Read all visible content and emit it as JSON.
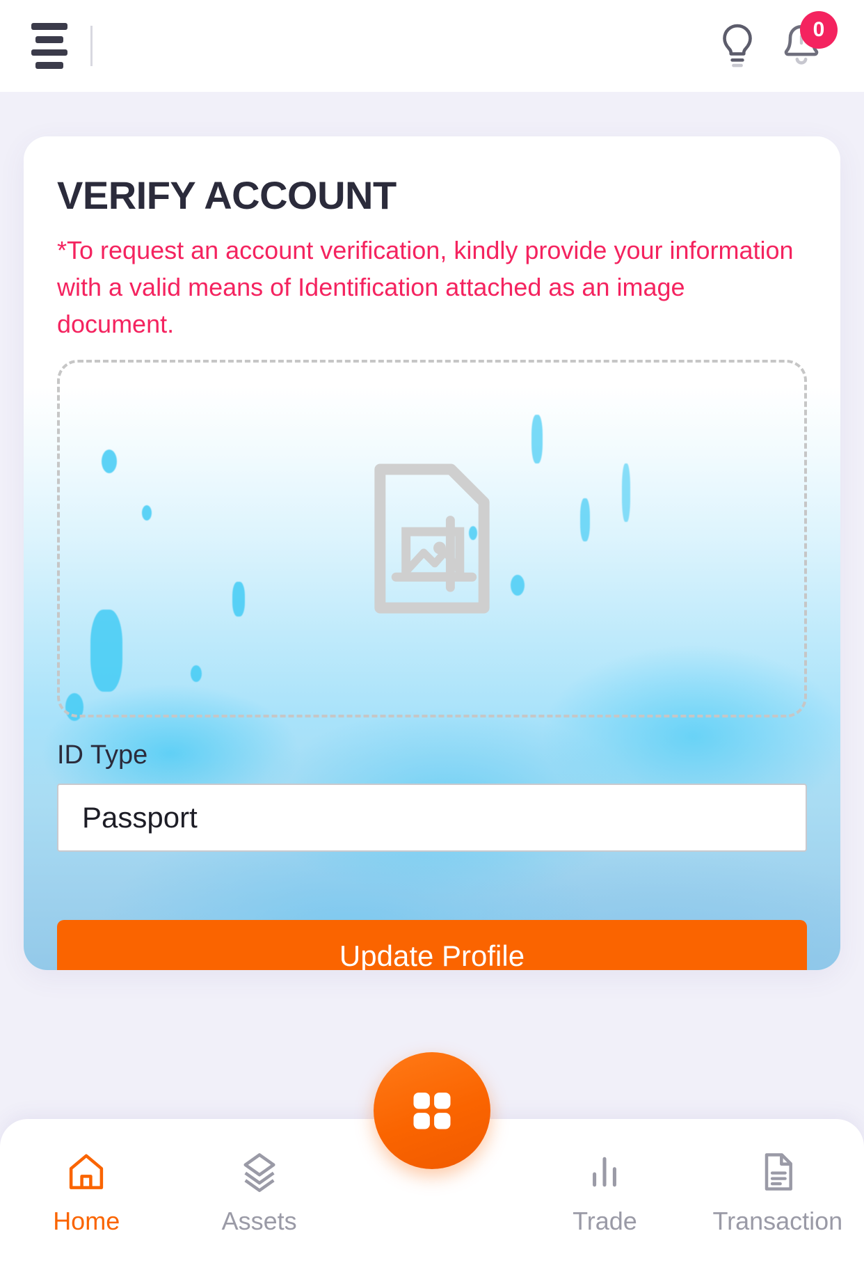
{
  "header": {
    "menu_icon": "hamburger-menu-icon",
    "hint_icon": "lightbulb-icon",
    "notifications_icon": "bell-icon",
    "notification_count": "0"
  },
  "card": {
    "title": "VERIFY ACCOUNT",
    "notice": "*To request an account verification, kindly provide your information with a valid means of Identification attached as an image document.",
    "dropzone": {
      "icon": "image-document-placeholder-icon"
    },
    "id_type": {
      "label": "ID Type",
      "value": "Passport"
    },
    "submit_label": "Update Profile"
  },
  "bottom_nav": {
    "items": [
      {
        "label": "Home",
        "icon": "home-icon",
        "active": true
      },
      {
        "label": "Assets",
        "icon": "layers-icon",
        "active": false
      },
      {
        "label": "Trade",
        "icon": "bar-chart-icon",
        "active": false
      },
      {
        "label": "Transaction",
        "icon": "document-icon",
        "active": false
      }
    ],
    "fab_icon": "grid-apps-icon"
  },
  "colors": {
    "accent_orange": "#FA6400",
    "notice_pink": "#F4235F",
    "badge_pink": "#F4235F",
    "page_background": "#F1F0F9",
    "title_dark": "#2B2B3B",
    "muted_gray": "#9A9AA6"
  }
}
